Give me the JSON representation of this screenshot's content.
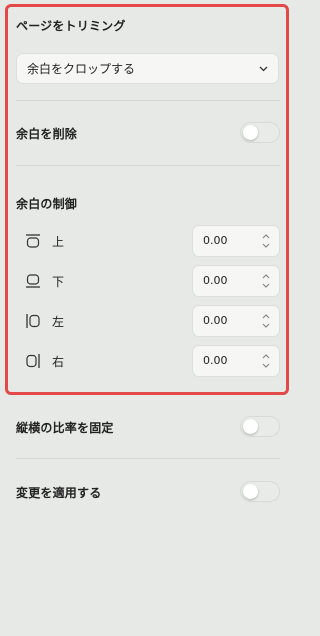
{
  "crop_section": {
    "title": "ページをトリミング",
    "dropdown_value": "余白をクロップする"
  },
  "remove_margins": {
    "label": "余白を削除",
    "enabled": false
  },
  "margin_control": {
    "title": "余白の制御",
    "rows": [
      {
        "label": "上",
        "value": "0.00",
        "icon": "top-margin-icon"
      },
      {
        "label": "下",
        "value": "0.00",
        "icon": "bottom-margin-icon"
      },
      {
        "label": "左",
        "value": "0.00",
        "icon": "left-margin-icon"
      },
      {
        "label": "右",
        "value": "0.00",
        "icon": "right-margin-icon"
      }
    ]
  },
  "lock_aspect": {
    "label": "縦横の比率を固定",
    "enabled": false
  },
  "apply_changes": {
    "label": "変更を適用する",
    "enabled": false
  },
  "colors": {
    "highlight_border": "#e24a4a",
    "background": "#e6e9e5"
  }
}
